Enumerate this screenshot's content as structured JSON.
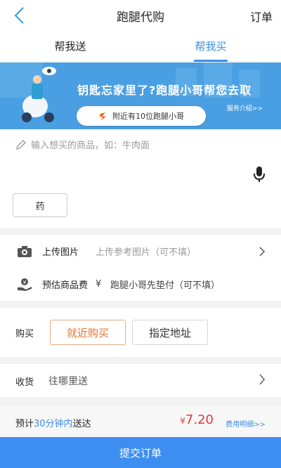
{
  "header": {
    "title": "跑腿代购",
    "right_label": "订单"
  },
  "tabs": [
    {
      "label": "帮我送",
      "active": false
    },
    {
      "label": "帮我买",
      "active": true
    }
  ],
  "banner": {
    "tagline": "钥匙忘家里了?跑腿小哥帮您去取",
    "link": "服务介绍>>",
    "pill_text": "附近有10位跑腿小哥"
  },
  "input": {
    "placeholder": "输入想买的商品，如：牛肉面",
    "quick_tag": "药"
  },
  "rows": {
    "upload_label": "上传图片",
    "upload_hint": "上传参考图片（可不填）",
    "fee_label": "预估商品费",
    "fee_symbol": "¥",
    "fee_hint": "跑腿小哥先垫付（可不填）"
  },
  "buy": {
    "label": "购买",
    "option_nearby": "就近购买",
    "option_address": "指定地址"
  },
  "receive": {
    "label": "收货",
    "value": "往哪里送"
  },
  "summary": {
    "est_prefix": "预计",
    "est_time": "30分钟内",
    "est_suffix": "送达",
    "price_symbol": "¥",
    "price_value": "7.20",
    "fee_link": "费用明细>>"
  },
  "submit_label": "提交订单",
  "colors": {
    "accent": "#3a8ee6",
    "price": "#e23b3b",
    "selected": "#e8732e",
    "banner": "#4a9fe2"
  }
}
